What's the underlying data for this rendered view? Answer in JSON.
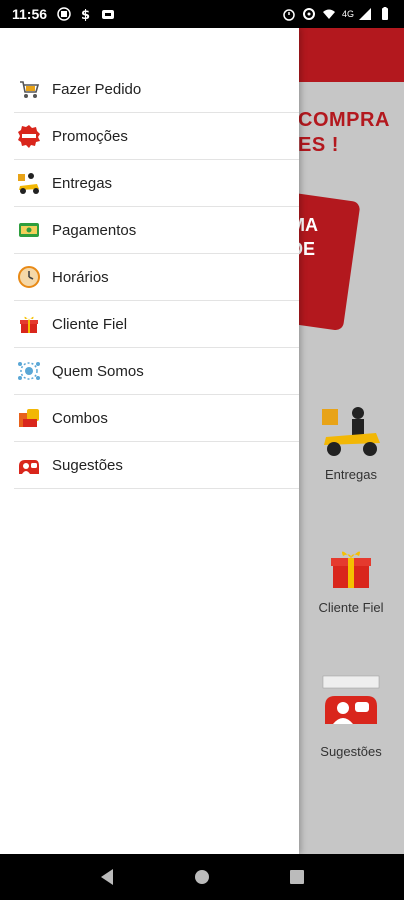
{
  "status_bar": {
    "time": "11:56",
    "network": "4G"
  },
  "background": {
    "promo_text": "COMPRA\nES !",
    "promo_card_text": "MA\nDE",
    "tiles": [
      {
        "label": "Entregas",
        "icon": "scooter-icon"
      },
      {
        "label": "Cliente Fiel",
        "icon": "gift-icon"
      },
      {
        "label": "Sugestões",
        "icon": "suggestion-icon"
      }
    ],
    "brand_color": "#b3181e"
  },
  "menu": {
    "items": [
      {
        "label": "Fazer Pedido",
        "icon": "cart-icon"
      },
      {
        "label": "Promoções",
        "icon": "promo-badge-icon"
      },
      {
        "label": "Entregas",
        "icon": "delivery-icon"
      },
      {
        "label": "Pagamentos",
        "icon": "money-icon"
      },
      {
        "label": "Horários",
        "icon": "clock-icon"
      },
      {
        "label": "Cliente Fiel",
        "icon": "gift-icon"
      },
      {
        "label": "Quem Somos",
        "icon": "about-icon"
      },
      {
        "label": "Combos",
        "icon": "combo-icon"
      },
      {
        "label": "Sugestões",
        "icon": "suggestion-icon"
      }
    ]
  },
  "nav": {
    "back": "back-icon",
    "home": "home-icon",
    "recents": "recents-icon"
  }
}
